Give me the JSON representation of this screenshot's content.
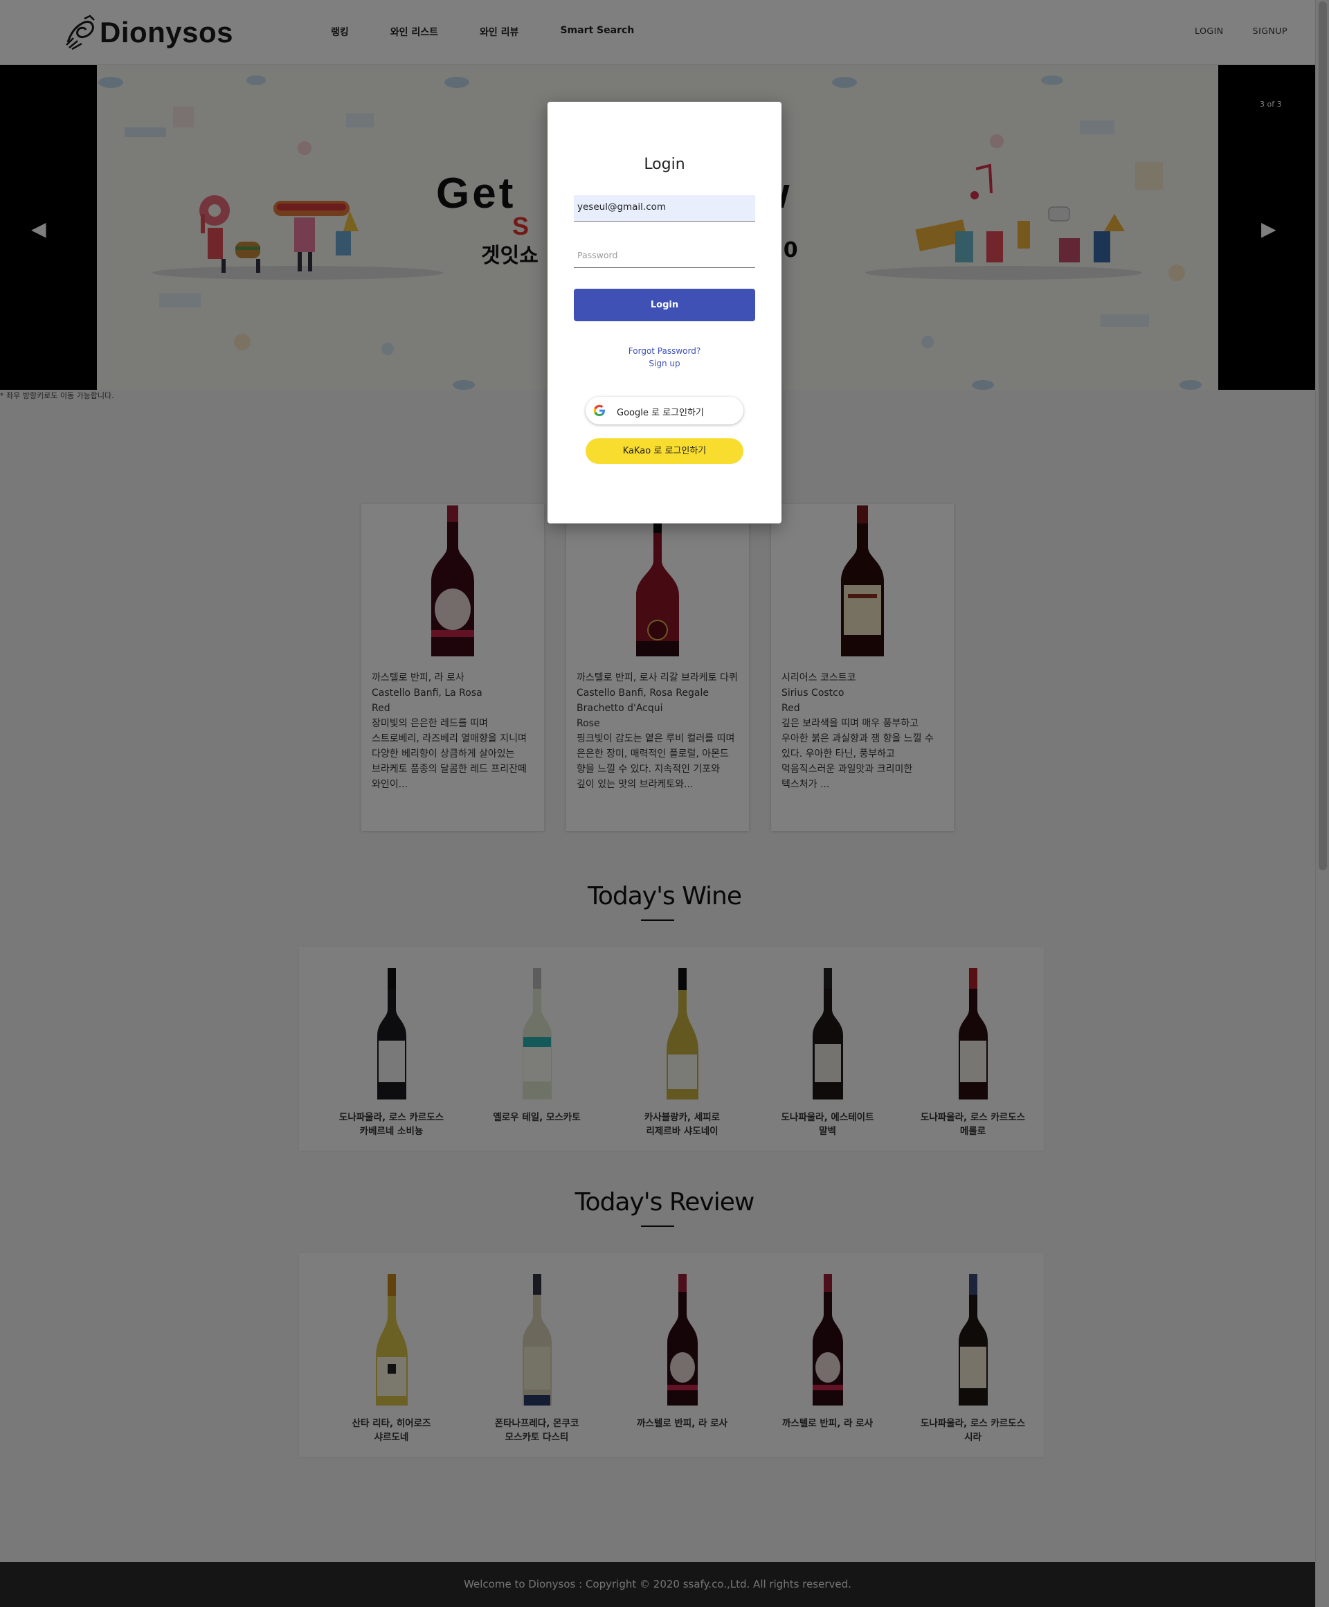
{
  "nav": {
    "logo": "Dionysos",
    "links": [
      "랭킹",
      "와인 리스트",
      "와인 리뷰",
      "Smart Search"
    ],
    "login": "LOGIN",
    "signup": "SIGNUP"
  },
  "carousel": {
    "counter": "3 of 3",
    "hint": "* 좌우 방향키로도 이동 가능합니다.",
    "banner_title_left": "Get",
    "banner_title_right": "ow",
    "banner_red": "S",
    "banner_kr_left": "겟잇쇼",
    "banner_kr_right": "020",
    "prev_arrow": "◀",
    "next_arrow": "▶"
  },
  "recommended": [
    {
      "name_kr": "까스텔로 반피, 라 로사",
      "name_en": "Castello Banfi, La Rosa",
      "type": "Red",
      "desc": "장미빛의 은은한 레드를 띠며 스트로베리, 라즈베리 열매향을 지니며 다양한 베리향이 상큼하게 살아있는 브라케토 품종의 달콤한 레드 프리잔떼 와인이..."
    },
    {
      "name_kr": "까스텔로 반피, 로사 리갈 브라케토 다퀴",
      "name_en": "Castello Banfi, Rosa Regale Brachetto d'Acqui",
      "type": "Rose",
      "desc": "핑크빛이 감도는 옅은 루비 컬러를 띠며 은은한 장미, 매력적인 플로럴, 아몬드 향을 느낄 수 있다. 지속적인 기포와 깊이 있는 맛의 브라케토와..."
    },
    {
      "name_kr": "시리어스 코스트코",
      "name_en": "Sirius Costco",
      "type": "Red",
      "desc": "깊은 보라색을 띠며 매우 풍부하고 우아한 붉은 과실향과 잼 향을 느낄 수 있다. 우아한 타닌, 풍부하고 먹음직스러운 과일맛과 크리미한 텍스처가 ..."
    }
  ],
  "todays_wine": {
    "title": "Today's Wine",
    "items": [
      {
        "name": "도나파울라, 로스 카르도스 카베르네 소비뇽"
      },
      {
        "name": "옐로우 테일, 모스카토"
      },
      {
        "name": "카사블랑카, 세피로 리제르바 샤도네이"
      },
      {
        "name": "도나파울라, 에스테이트 말벡"
      },
      {
        "name": "도나파울라, 로스 카르도스 메롤로"
      }
    ]
  },
  "todays_review": {
    "title": "Today's Review",
    "items": [
      {
        "name": "산타 리타, 히어로즈 샤르도네"
      },
      {
        "name": "폰타나프레다, 몬쿠코 모스카토 다스티"
      },
      {
        "name": "까스텔로 반피, 라 로사"
      },
      {
        "name": "까스텔로 반피, 라 로사"
      },
      {
        "name": "도나파울라, 로스 카르도스 시라"
      }
    ]
  },
  "footer": {
    "text": "Welcome to Dionysos : Copyright © 2020 ssafy.co.,Ltd. All rights reserved."
  },
  "login_modal": {
    "title": "Login",
    "email_value": "yeseul@gmail.com",
    "password_placeholder": "Password",
    "login_button": "Login",
    "forgot": "Forgot Password?",
    "signup": "Sign up",
    "google": "Google 로 로그인하기",
    "kakao": "KaKao 로 로그인하기"
  },
  "colors": {
    "primary": "#3f51b5",
    "kakao": "#f8dd2e",
    "footer_bg": "#2a2a2a",
    "overlay": "rgba(0,0,0,0.5)"
  }
}
